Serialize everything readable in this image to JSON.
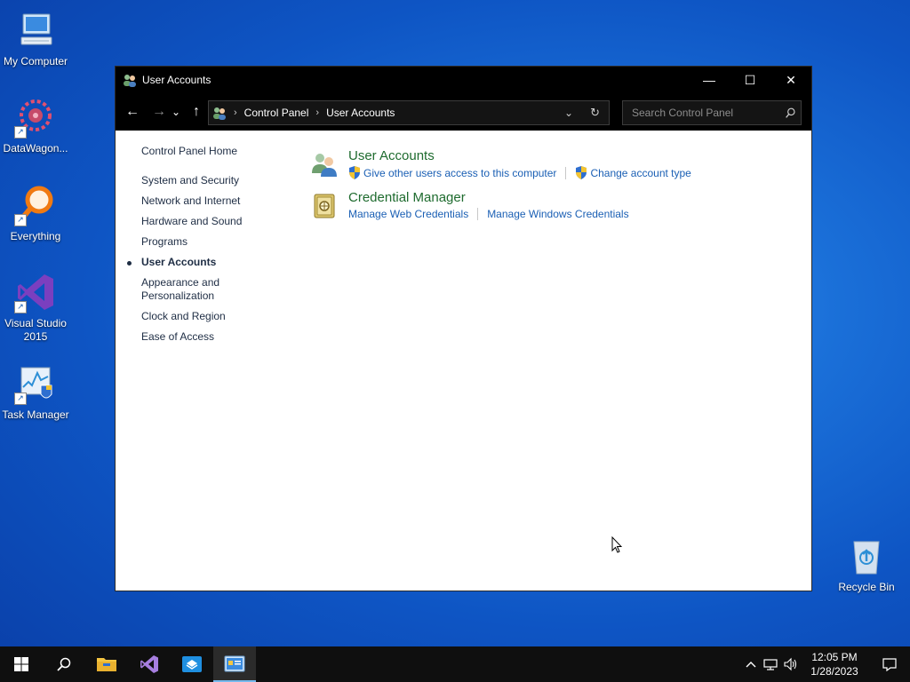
{
  "desktop": {
    "icons": [
      {
        "label": "My Computer",
        "icon": "computer-icon"
      },
      {
        "label": "DataWagon...",
        "icon": "datawagon-icon"
      },
      {
        "label": "Everything",
        "icon": "everything-search-icon"
      },
      {
        "label": "Visual Studio 2015",
        "icon": "visual-studio-icon"
      },
      {
        "label": "Task Manager",
        "icon": "task-manager-icon"
      },
      {
        "label": "Recycle Bin",
        "icon": "recycle-bin-icon"
      }
    ]
  },
  "window": {
    "title": "User Accounts",
    "controls": {
      "minimize": "—",
      "maximize": "☐",
      "close": "✕"
    },
    "address": {
      "crumbs": [
        "Control Panel",
        "User Accounts"
      ],
      "refresh": "↻",
      "dropdown": "⌄"
    },
    "search": {
      "placeholder": "Search Control Panel"
    },
    "nav": {
      "back": "←",
      "forward": "→",
      "recent": "⌄",
      "up": "↑"
    }
  },
  "leftnav": {
    "home": "Control Panel Home",
    "items": [
      "System and Security",
      "Network and Internet",
      "Hardware and Sound",
      "Programs",
      "User Accounts",
      "Appearance and Personalization",
      "Clock and Region",
      "Ease of Access"
    ],
    "active_index": 4
  },
  "main": {
    "sections": [
      {
        "title": "User Accounts",
        "links": [
          "Give other users access to this computer",
          "Change account type"
        ]
      },
      {
        "title": "Credential Manager",
        "links": [
          "Manage Web Credentials",
          "Manage Windows Credentials"
        ]
      }
    ]
  },
  "taskbar": {
    "apps": [
      "start-icon",
      "search-icon",
      "file-explorer-icon",
      "visual-studio-icon",
      "app-installer-icon",
      "control-panel-icon"
    ],
    "active_app": "control-panel-icon",
    "tray": {
      "chevron": "^",
      "time": "12:05 PM",
      "date": "1/28/2023"
    }
  },
  "colors": {
    "link": "#1a5fb4",
    "section_title": "#1e6b2e",
    "titlebar": "#000000",
    "taskbar": "#0f0f0f"
  }
}
